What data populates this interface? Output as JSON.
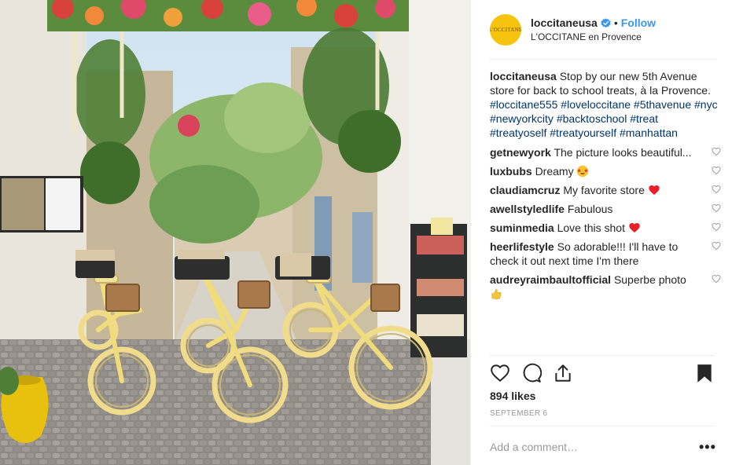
{
  "post": {
    "username": "loccitaneusa",
    "verified": true,
    "follow_label": "Follow",
    "dot": "•",
    "location": "L'OCCITANE en Provence",
    "avatar_text": "L'OCCITANE",
    "caption": {
      "username": "loccitaneusa",
      "text": "Stop by our new 5th Avenue store for back to school treats, à la Provence.",
      "hashtags": [
        "#loccitane555",
        "#loveloccitane",
        "#5thavenue",
        "#nyc",
        "#newyorkcity",
        "#backtoschool",
        "#treat",
        "#treatyoself",
        "#treatyourself",
        "#manhattan"
      ]
    },
    "comments": [
      {
        "username": "getnewyork",
        "text": "The picture looks beautiful...",
        "emoji": ""
      },
      {
        "username": "luxbubs",
        "text": "Dreamy",
        "emoji": "star-struck-emoji"
      },
      {
        "username": "claudiamcruz",
        "text": "My favorite store",
        "emoji": "red-heart-emoji"
      },
      {
        "username": "awellstyledlife",
        "text": "Fabulous",
        "emoji": ""
      },
      {
        "username": "suminmedia",
        "text": "Love this shot",
        "emoji": "red-heart-emoji"
      },
      {
        "username": "heerlifestyle",
        "text": "So adorable!!! I'll have to check it out next time I'm there",
        "emoji": ""
      },
      {
        "username": "audreyraimbaultofficial",
        "text": "Superbe photo",
        "emoji": "thumbs-up-emoji"
      }
    ],
    "likes": "894 likes",
    "date": "SEPTEMBER 6",
    "comment_placeholder": "Add a comment…",
    "more_label": "•••",
    "icons": [
      "heart-icon",
      "comment-icon",
      "share-icon",
      "bookmark-icon",
      "verified-badge-icon",
      "like-comment-heart-icon"
    ],
    "colors": {
      "follow": "#3897f0",
      "hashtag": "#003569",
      "avatar": "#f6c40f",
      "verified": "#3897f0",
      "muted": "#999999"
    }
  }
}
